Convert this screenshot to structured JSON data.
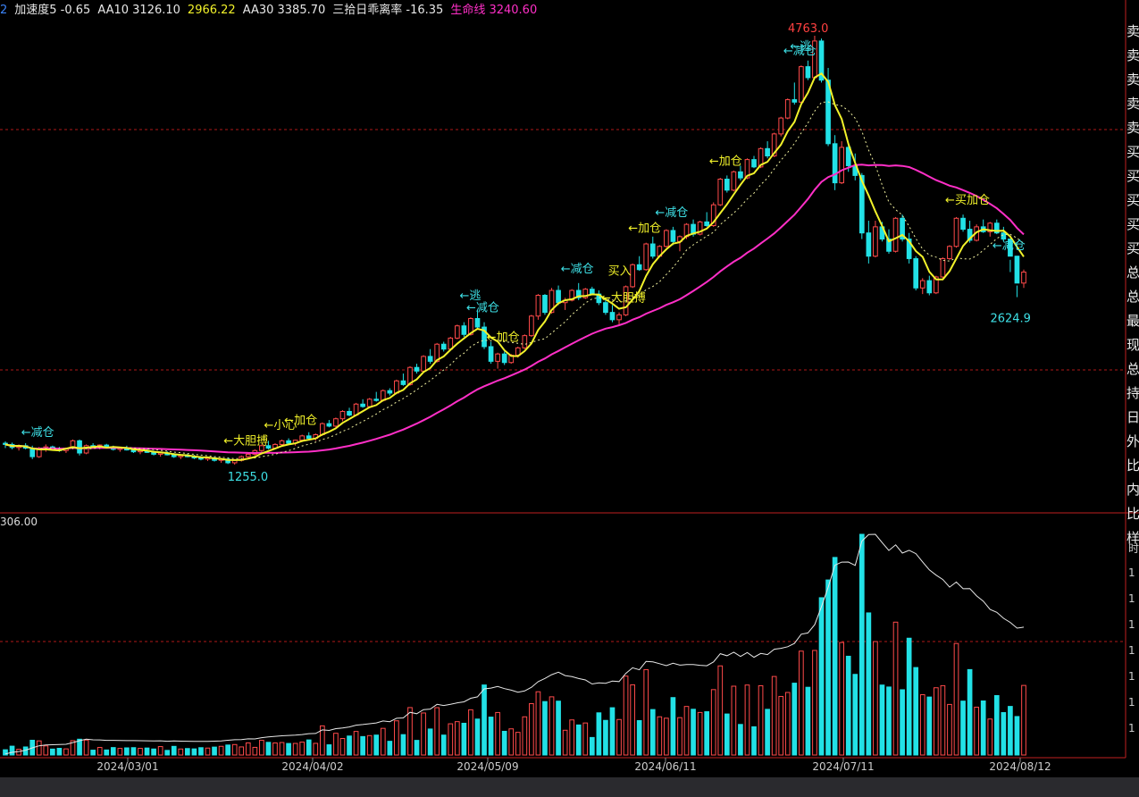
{
  "legend": {
    "fragment": "2",
    "items": [
      {
        "label": "加速度5",
        "value": "-0.65",
        "color": "#e8e8e8"
      },
      {
        "label": "AA10",
        "value": "3126.10",
        "color": "#e8e8e8"
      },
      {
        "label": "",
        "value": "2966.22",
        "color": "#f2f22a"
      },
      {
        "label": "AA30",
        "value": "3385.70",
        "color": "#e8e8e8"
      },
      {
        "label": "三拾日乖离率",
        "value": "-16.35",
        "color": "#e8e8e8"
      },
      {
        "label": "生命线",
        "value": "3240.60",
        "color": "#ff2fc7"
      }
    ]
  },
  "volume_label": "306.00",
  "sidebar_chars": [
    "卖",
    "卖",
    "卖",
    "卖",
    "卖",
    "买",
    "买",
    "买",
    "买",
    "买",
    "总",
    "总",
    "最",
    "现",
    "总",
    "持",
    "日",
    "外",
    "比",
    "内",
    "比",
    "样"
  ],
  "volume_ticks": [
    "时",
    "1",
    "1",
    "1",
    "1",
    "1",
    "1",
    "1"
  ],
  "price_marks": [
    {
      "text": "4763.0",
      "color": "#ff4040"
    },
    {
      "text": "2624.9",
      "color": "#3ee0e6"
    },
    {
      "text": "1255.0",
      "color": "#3ee0e6"
    }
  ],
  "colors": {
    "up": "#ff4a4a",
    "down": "#22e1e6",
    "ma5": "#f2f22a",
    "life": "#ff2fc7",
    "grid": "#b01818",
    "axis": "#c02020"
  },
  "chart_data": {
    "type": "candlestick",
    "x_ticks": [
      "2024/03/01",
      "2024/04/02",
      "2024/05/09",
      "2024/06/11",
      "2024/07/11",
      "2024/08/12"
    ],
    "candles": [
      [
        1430,
        1445,
        1390,
        1420
      ],
      [
        1420,
        1435,
        1380,
        1395
      ],
      [
        1395,
        1420,
        1370,
        1410
      ],
      [
        1410,
        1430,
        1380,
        1390
      ],
      [
        1390,
        1410,
        1300,
        1320
      ],
      [
        1320,
        1400,
        1310,
        1380
      ],
      [
        1380,
        1420,
        1360,
        1400
      ],
      [
        1400,
        1410,
        1370,
        1385
      ],
      [
        1385,
        1400,
        1360,
        1370
      ],
      [
        1370,
        1395,
        1350,
        1390
      ],
      [
        1390,
        1460,
        1380,
        1450
      ],
      [
        1450,
        1460,
        1330,
        1350
      ],
      [
        1350,
        1420,
        1340,
        1410
      ],
      [
        1410,
        1430,
        1390,
        1400
      ],
      [
        1400,
        1420,
        1380,
        1415
      ],
      [
        1415,
        1425,
        1390,
        1395
      ],
      [
        1395,
        1410,
        1370,
        1380
      ],
      [
        1380,
        1400,
        1360,
        1390
      ],
      [
        1390,
        1410,
        1370,
        1375
      ],
      [
        1375,
        1390,
        1350,
        1360
      ],
      [
        1360,
        1380,
        1340,
        1370
      ],
      [
        1370,
        1385,
        1350,
        1355
      ],
      [
        1355,
        1370,
        1330,
        1340
      ],
      [
        1340,
        1360,
        1320,
        1350
      ],
      [
        1350,
        1365,
        1330,
        1335
      ],
      [
        1335,
        1350,
        1310,
        1320
      ],
      [
        1320,
        1340,
        1300,
        1330
      ],
      [
        1330,
        1345,
        1315,
        1320
      ],
      [
        1320,
        1335,
        1300,
        1310
      ],
      [
        1310,
        1325,
        1290,
        1300
      ],
      [
        1300,
        1320,
        1285,
        1310
      ],
      [
        1310,
        1320,
        1280,
        1290
      ],
      [
        1290,
        1310,
        1270,
        1300
      ],
      [
        1300,
        1315,
        1260,
        1270
      ],
      [
        1270,
        1300,
        1255,
        1290
      ],
      [
        1290,
        1330,
        1280,
        1320
      ],
      [
        1320,
        1350,
        1300,
        1340
      ],
      [
        1340,
        1380,
        1330,
        1370
      ],
      [
        1370,
        1420,
        1360,
        1410
      ],
      [
        1410,
        1450,
        1380,
        1390
      ],
      [
        1390,
        1430,
        1380,
        1420
      ],
      [
        1420,
        1460,
        1400,
        1450
      ],
      [
        1450,
        1470,
        1420,
        1430
      ],
      [
        1430,
        1460,
        1410,
        1455
      ],
      [
        1455,
        1500,
        1440,
        1490
      ],
      [
        1490,
        1520,
        1460,
        1470
      ],
      [
        1470,
        1510,
        1450,
        1500
      ],
      [
        1500,
        1600,
        1490,
        1590
      ],
      [
        1590,
        1620,
        1560,
        1570
      ],
      [
        1570,
        1640,
        1560,
        1630
      ],
      [
        1630,
        1700,
        1610,
        1690
      ],
      [
        1690,
        1720,
        1650,
        1660
      ],
      [
        1660,
        1760,
        1650,
        1750
      ],
      [
        1750,
        1790,
        1720,
        1730
      ],
      [
        1730,
        1800,
        1720,
        1790
      ],
      [
        1790,
        1850,
        1770,
        1780
      ],
      [
        1780,
        1870,
        1770,
        1860
      ],
      [
        1860,
        1880,
        1820,
        1840
      ],
      [
        1840,
        1950,
        1830,
        1940
      ],
      [
        1940,
        2000,
        1900,
        1910
      ],
      [
        1910,
        2060,
        1900,
        2050
      ],
      [
        2050,
        2080,
        2000,
        2020
      ],
      [
        2020,
        2150,
        2010,
        2140
      ],
      [
        2140,
        2200,
        2080,
        2100
      ],
      [
        2100,
        2250,
        2090,
        2240
      ],
      [
        2240,
        2260,
        2180,
        2200
      ],
      [
        2200,
        2300,
        2190,
        2290
      ],
      [
        2290,
        2400,
        2280,
        2390
      ],
      [
        2390,
        2420,
        2300,
        2320
      ],
      [
        2320,
        2460,
        2310,
        2450
      ],
      [
        2450,
        2520,
        2370,
        2380
      ],
      [
        2380,
        2420,
        2200,
        2220
      ],
      [
        2220,
        2260,
        2080,
        2100
      ],
      [
        2100,
        2170,
        2040,
        2160
      ],
      [
        2160,
        2180,
        2070,
        2090
      ],
      [
        2090,
        2160,
        2080,
        2150
      ],
      [
        2150,
        2220,
        2130,
        2210
      ],
      [
        2210,
        2320,
        2200,
        2310
      ],
      [
        2310,
        2480,
        2300,
        2470
      ],
      [
        2470,
        2650,
        2440,
        2640
      ],
      [
        2640,
        2650,
        2480,
        2500
      ],
      [
        2500,
        2700,
        2490,
        2680
      ],
      [
        2680,
        2720,
        2560,
        2580
      ],
      [
        2580,
        2620,
        2520,
        2600
      ],
      [
        2600,
        2690,
        2590,
        2680
      ],
      [
        2680,
        2740,
        2600,
        2620
      ],
      [
        2620,
        2700,
        2610,
        2690
      ],
      [
        2690,
        2710,
        2640,
        2650
      ],
      [
        2650,
        2680,
        2560,
        2580
      ],
      [
        2580,
        2600,
        2480,
        2500
      ],
      [
        2500,
        2560,
        2420,
        2440
      ],
      [
        2440,
        2500,
        2390,
        2480
      ],
      [
        2480,
        2720,
        2470,
        2710
      ],
      [
        2710,
        2900,
        2700,
        2890
      ],
      [
        2890,
        2960,
        2840,
        2850
      ],
      [
        2850,
        3070,
        2840,
        3060
      ],
      [
        3060,
        3120,
        2940,
        2960
      ],
      [
        2960,
        3050,
        2950,
        3040
      ],
      [
        3040,
        3180,
        3030,
        3170
      ],
      [
        3170,
        3200,
        3050,
        3080
      ],
      [
        3080,
        3130,
        3000,
        3120
      ],
      [
        3120,
        3230,
        3100,
        3220
      ],
      [
        3220,
        3260,
        3120,
        3140
      ],
      [
        3140,
        3250,
        3130,
        3240
      ],
      [
        3240,
        3320,
        3200,
        3210
      ],
      [
        3210,
        3400,
        3200,
        3380
      ],
      [
        3380,
        3600,
        3370,
        3590
      ],
      [
        3590,
        3620,
        3480,
        3500
      ],
      [
        3500,
        3660,
        3490,
        3650
      ],
      [
        3650,
        3700,
        3580,
        3600
      ],
      [
        3600,
        3760,
        3590,
        3750
      ],
      [
        3750,
        3780,
        3680,
        3690
      ],
      [
        3690,
        3850,
        3680,
        3840
      ],
      [
        3840,
        3900,
        3760,
        3780
      ],
      [
        3780,
        3970,
        3770,
        3960
      ],
      [
        3960,
        4100,
        3940,
        4090
      ],
      [
        4090,
        4250,
        4080,
        4240
      ],
      [
        4240,
        4380,
        4200,
        4220
      ],
      [
        4220,
        4520,
        4210,
        4510
      ],
      [
        4510,
        4560,
        4400,
        4420
      ],
      [
        4420,
        4763,
        4410,
        4720
      ],
      [
        4720,
        4740,
        4380,
        4400
      ],
      [
        4400,
        4500,
        3860,
        3880
      ],
      [
        3880,
        3950,
        3500,
        3560
      ],
      [
        3560,
        3900,
        3550,
        3850
      ],
      [
        3850,
        3880,
        3650,
        3700
      ],
      [
        3700,
        3800,
        3580,
        3620
      ],
      [
        3620,
        3640,
        3100,
        3150
      ],
      [
        3150,
        3250,
        2900,
        2960
      ],
      [
        2960,
        3250,
        2950,
        3200
      ],
      [
        3200,
        3240,
        3080,
        3100
      ],
      [
        3100,
        3180,
        2980,
        3000
      ],
      [
        3000,
        3280,
        2990,
        3270
      ],
      [
        3270,
        3300,
        3080,
        3100
      ],
      [
        3100,
        3150,
        2900,
        2940
      ],
      [
        2940,
        2960,
        2680,
        2700
      ],
      [
        2700,
        2780,
        2650,
        2760
      ],
      [
        2760,
        2800,
        2640,
        2660
      ],
      [
        2660,
        2800,
        2650,
        2790
      ],
      [
        2790,
        2950,
        2780,
        2940
      ],
      [
        2940,
        3050,
        2930,
        3040
      ],
      [
        3040,
        3280,
        3030,
        3270
      ],
      [
        3270,
        3300,
        3160,
        3180
      ],
      [
        3180,
        3250,
        3070,
        3090
      ],
      [
        3090,
        3220,
        3080,
        3200
      ],
      [
        3200,
        3260,
        3150,
        3160
      ],
      [
        3160,
        3240,
        3120,
        3230
      ],
      [
        3230,
        3260,
        3140,
        3150
      ],
      [
        3150,
        3200,
        3080,
        3100
      ],
      [
        3100,
        2930,
        2830,
        2960
      ],
      [
        2960,
        2720,
        2624.9,
        2740
      ],
      [
        2740,
        2850,
        2700,
        2830
      ]
    ],
    "volume_max": 306.0,
    "series": [
      {
        "name": "AA10",
        "value": 3126.1
      },
      {
        "name": "AA30",
        "value": 3385.7
      },
      {
        "name": "生命线",
        "value": 3240.6
      }
    ],
    "annotations": [
      {
        "i": 5,
        "text": "←减仓",
        "color": "#3ee0e6"
      },
      {
        "i": 35,
        "text": "←大胆搏",
        "color": "#f2f22a"
      },
      {
        "i": 41,
        "text": "←小心",
        "color": "#f2f22a"
      },
      {
        "i": 44,
        "text": "←加仓",
        "color": "#f2f22a"
      },
      {
        "i": 70,
        "text": "←逃",
        "color": "#3ee0e6"
      },
      {
        "i": 71,
        "text": "←减仓",
        "color": "#3ee0e6"
      },
      {
        "i": 74,
        "text": "←加仓",
        "color": "#f2f22a"
      },
      {
        "i": 85,
        "text": "←减仓",
        "color": "#3ee0e6"
      },
      {
        "i": 91,
        "text": "←大胆搏",
        "color": "#f2f22a"
      },
      {
        "i": 92,
        "text": "买入",
        "color": "#f2f22a"
      },
      {
        "i": 95,
        "text": "←加仓",
        "color": "#f2f22a"
      },
      {
        "i": 99,
        "text": "←减仓",
        "color": "#3ee0e6"
      },
      {
        "i": 107,
        "text": "←加仓",
        "color": "#f2f22a"
      },
      {
        "i": 118,
        "text": "←减仓",
        "color": "#3ee0e6"
      },
      {
        "i": 119,
        "text": "←逃",
        "color": "#3ee0e6"
      },
      {
        "i": 142,
        "text": "←买加仓",
        "color": "#f2f22a"
      },
      {
        "i": 149,
        "text": "←减仓",
        "color": "#3ee0e6"
      }
    ]
  }
}
